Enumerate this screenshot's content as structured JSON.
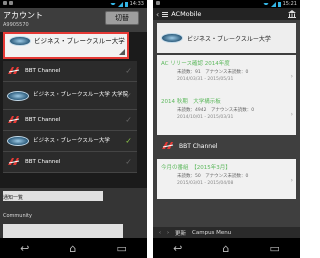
{
  "left": {
    "status_time": "14:33",
    "account_title": "アカウント",
    "account_id": "A9905570",
    "switch_label": "切替",
    "current_group": "ビジネス・ブレークスルー大学",
    "groups": [
      {
        "label": "BBT Channel",
        "logo": "bbt-logo",
        "selected": false
      },
      {
        "label": "ビジネス・ブレークスルー大学 大学院",
        "logo": "ac-logo",
        "selected": false
      },
      {
        "label": "BBT Channel",
        "logo": "bbt-logo",
        "selected": false
      },
      {
        "label": "ビジネス・ブレークスルー大学",
        "logo": "ac-logo",
        "selected": true
      },
      {
        "label": "BBT Channel",
        "logo": "bbt-logo",
        "selected": false
      }
    ],
    "menu": {
      "notifications": "通知一覧",
      "community": "Community"
    },
    "colors": {
      "highlight": "#e53935",
      "check": "#8bc34a"
    }
  },
  "right": {
    "status_time": "15:21",
    "app_title": "ACMobile",
    "header_card_title": "ビジネス・ブレークスルー大学",
    "items": [
      {
        "title": "AC リリース確認 2014年度",
        "meta": "未読数：91　アナウンス未読数：0",
        "dates": "2014/03/31 - 2015/05/31"
      },
      {
        "title": "2014 秋期　大学構示板",
        "meta": "未読数：4942　アナウンス未読数：0",
        "dates": "2014/10/01 - 2015/03/31"
      }
    ],
    "channel_title": "BBT Channel",
    "channel_item": {
      "title": "今月の番組　【2015年3月】",
      "meta": "未読数：50　アナウンス未読数：0",
      "dates": "2015/03/01 - 2015/04/08"
    },
    "bottom": {
      "update": "更新",
      "campus_menu": "Campus Menu"
    },
    "colors": {
      "green": "#5cb85c"
    }
  }
}
